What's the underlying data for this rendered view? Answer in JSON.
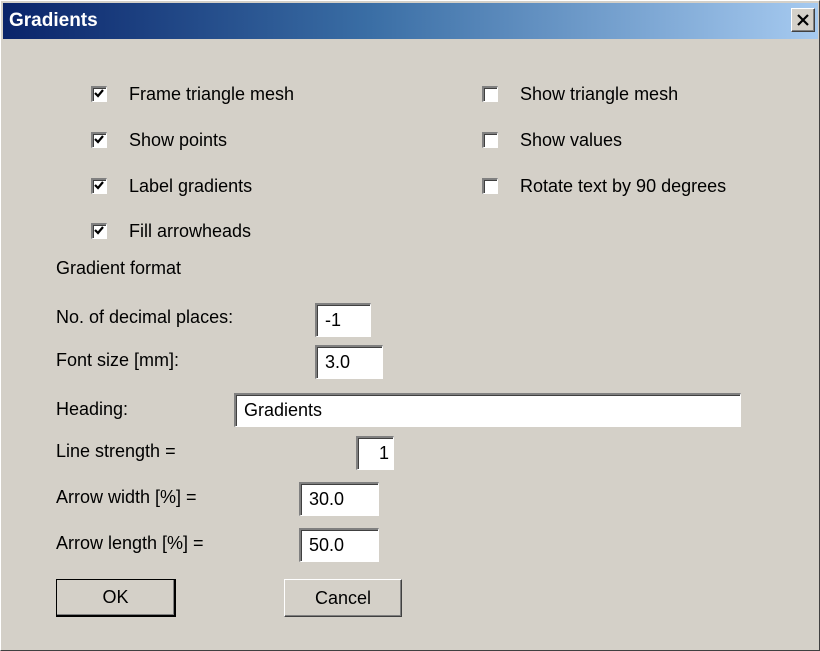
{
  "window": {
    "title": "Gradients"
  },
  "checkboxes": {
    "frame_triangle_mesh": {
      "label": "Frame triangle mesh",
      "checked": true
    },
    "show_points": {
      "label": "Show points",
      "checked": true
    },
    "label_gradients": {
      "label": "Label gradients",
      "checked": true
    },
    "fill_arrowheads": {
      "label": "Fill arrowheads",
      "checked": true
    },
    "show_triangle_mesh": {
      "label": "Show triangle mesh",
      "checked": false
    },
    "show_values": {
      "label": "Show values",
      "checked": false
    },
    "rotate_text": {
      "label": "Rotate text by 90 degrees",
      "checked": false
    }
  },
  "gradient_format": {
    "label": "Gradient format"
  },
  "fields": {
    "decimal_places": {
      "label": "No. of decimal places:",
      "value": "-1"
    },
    "font_size": {
      "label": "Font size [mm]:",
      "value": "3.0"
    },
    "heading": {
      "label": "Heading:",
      "value": "Gradients"
    },
    "line_strength": {
      "label": "Line strength  =",
      "value": "1"
    },
    "arrow_width": {
      "label": "Arrow width [%] =",
      "value": "30.0"
    },
    "arrow_length": {
      "label": "Arrow length [%] =",
      "value": "50.0"
    }
  },
  "buttons": {
    "ok": "OK",
    "cancel": "Cancel"
  },
  "icons": {
    "close": "close-icon",
    "check": "checkmark-icon"
  }
}
